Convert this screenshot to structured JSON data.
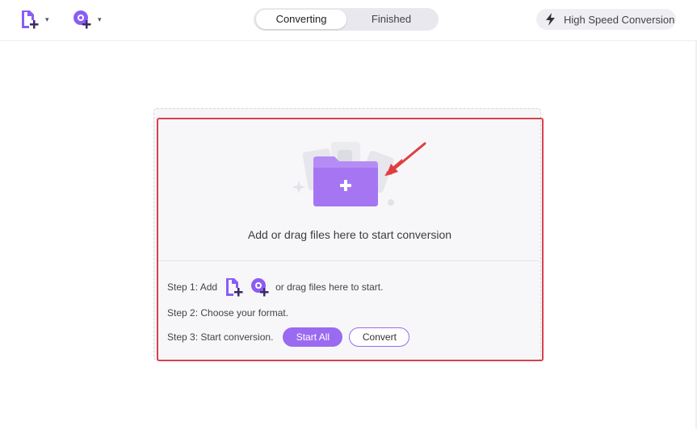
{
  "toolbar": {
    "add_files_icon": "add-file-icon",
    "add_screen_icon": "add-capture-icon",
    "caret": "▾"
  },
  "tabs": [
    {
      "label": "Converting",
      "active": true
    },
    {
      "label": "Finished",
      "active": false
    }
  ],
  "high_speed": {
    "label": "High Speed Conversion",
    "icon": "lightning-icon"
  },
  "dropzone": {
    "prompt": "Add or drag files here to start conversion"
  },
  "steps": {
    "step1_prefix": "Step 1: Add",
    "step1_suffix": "or drag files here to start.",
    "step2": "Step 2: Choose your format.",
    "step3": "Step 3: Start conversion."
  },
  "buttons": {
    "start_all": "Start All",
    "convert": "Convert"
  },
  "colors": {
    "accent": "#9a6af0",
    "highlight": "#d9414b",
    "arrow": "#e03e3e"
  }
}
